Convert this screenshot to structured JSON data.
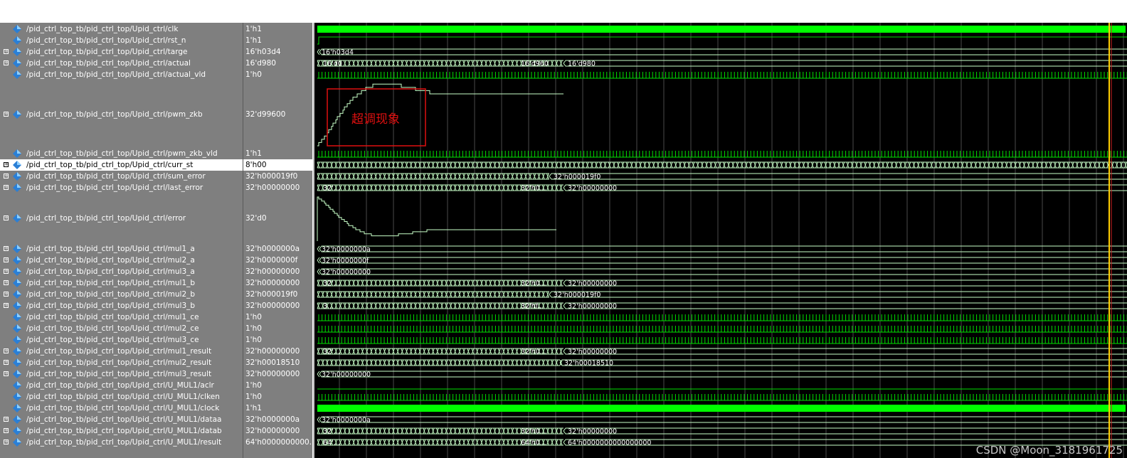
{
  "signals": [
    {
      "name": "/pid_ctrl_top_tb/pid_ctrl_top/Upid_ctrl/clk",
      "value": "1'h1",
      "expandable": false,
      "kind": "clk",
      "h": 16
    },
    {
      "name": "/pid_ctrl_top_tb/pid_ctrl_top/Upid_ctrl/rst_n",
      "value": "1'h1",
      "expandable": false,
      "kind": "high",
      "h": 16
    },
    {
      "name": "/pid_ctrl_top_tb/pid_ctrl_top/Upid_ctrl/targe",
      "value": "16'h03d4",
      "expandable": true,
      "kind": "bus",
      "h": 16,
      "labels": [
        "16'h03d4"
      ]
    },
    {
      "name": "/pid_ctrl_top_tb/pid_ctrl_top/Upid_ctrl/actual",
      "value": "16'd980",
      "expandable": true,
      "kind": "bus",
      "h": 16,
      "labels": [
        "16'd0",
        "16'd960",
        "16'd980"
      ]
    },
    {
      "name": "/pid_ctrl_top_tb/pid_ctrl_top/Upid_ctrl/actual_vld",
      "value": "1'h0",
      "expandable": false,
      "kind": "pulse",
      "h": 16
    },
    {
      "name": "/pid_ctrl_top_tb/pid_ctrl_top/Upid_ctrl/pwm_zkb",
      "value": "32'd99600",
      "expandable": true,
      "kind": "analog_up",
      "h": 95
    },
    {
      "name": "/pid_ctrl_top_tb/pid_ctrl_top/Upid_ctrl/pwm_zkb_vld",
      "value": "1'h1",
      "expandable": false,
      "kind": "pulse",
      "h": 16
    },
    {
      "name": "/pid_ctrl_top_tb/pid_ctrl_top/Upid_ctrl/curr_st",
      "value": "8'h00",
      "expandable": true,
      "kind": "bus",
      "h": 16,
      "selected": true,
      "labels": []
    },
    {
      "name": "/pid_ctrl_top_tb/pid_ctrl_top/Upid_ctrl/sum_error",
      "value": "32'h000019f0",
      "expandable": true,
      "kind": "bus",
      "h": 16,
      "labels": [
        "32'h000019f0"
      ]
    },
    {
      "name": "/pid_ctrl_top_tb/pid_ctrl_top/Upid_ctrl/last_error",
      "value": "32'h00000000",
      "expandable": true,
      "kind": "bus",
      "h": 16,
      "labels": [
        "32'...",
        "32'h0...",
        "32'h00000000"
      ]
    },
    {
      "name": "/pid_ctrl_top_tb/pid_ctrl_top/Upid_ctrl/error",
      "value": "32'd0",
      "expandable": true,
      "kind": "analog_down",
      "h": 70
    },
    {
      "name": "/pid_ctrl_top_tb/pid_ctrl_top/Upid_ctrl/mul1_a",
      "value": "32'h0000000a",
      "expandable": true,
      "kind": "bus",
      "h": 16,
      "labels": [
        "32'h0000000a"
      ]
    },
    {
      "name": "/pid_ctrl_top_tb/pid_ctrl_top/Upid_ctrl/mul2_a",
      "value": "32'h0000000f",
      "expandable": true,
      "kind": "bus",
      "h": 16,
      "labels": [
        "32'h0000000f"
      ]
    },
    {
      "name": "/pid_ctrl_top_tb/pid_ctrl_top/Upid_ctrl/mul3_a",
      "value": "32'h00000000",
      "expandable": true,
      "kind": "bus",
      "h": 16,
      "labels": [
        "32'h00000000"
      ]
    },
    {
      "name": "/pid_ctrl_top_tb/pid_ctrl_top/Upid_ctrl/mul1_b",
      "value": "32'h00000000",
      "expandable": true,
      "kind": "bus",
      "h": 16,
      "labels": [
        "32'...",
        "32'h0...",
        "32'h00000000"
      ]
    },
    {
      "name": "/pid_ctrl_top_tb/pid_ctrl_top/Upid_ctrl/mul2_b",
      "value": "32'h000019f0",
      "expandable": true,
      "kind": "bus",
      "h": 16,
      "labels": [
        "32'h000019f0"
      ]
    },
    {
      "name": "/pid_ctrl_top_tb/pid_ctrl_top/Upid_ctrl/mul3_b",
      "value": "32'h00000000",
      "expandable": true,
      "kind": "bus",
      "h": 16,
      "labels": [
        "3...",
        "32'hf...",
        "32'h...",
        "32'h00000000"
      ]
    },
    {
      "name": "/pid_ctrl_top_tb/pid_ctrl_top/Upid_ctrl/mul1_ce",
      "value": "1'h0",
      "expandable": false,
      "kind": "pulse",
      "h": 16
    },
    {
      "name": "/pid_ctrl_top_tb/pid_ctrl_top/Upid_ctrl/mul2_ce",
      "value": "1'h0",
      "expandable": false,
      "kind": "pulse",
      "h": 16
    },
    {
      "name": "/pid_ctrl_top_tb/pid_ctrl_top/Upid_ctrl/mul3_ce",
      "value": "1'h0",
      "expandable": false,
      "kind": "pulse",
      "h": 16
    },
    {
      "name": "/pid_ctrl_top_tb/pid_ctrl_top/Upid_ctrl/mul1_result",
      "value": "32'h00000000",
      "expandable": true,
      "kind": "bus",
      "h": 16,
      "labels": [
        "32'...",
        "32'h0...",
        "32'h00000000"
      ]
    },
    {
      "name": "/pid_ctrl_top_tb/pid_ctrl_top/Upid_ctrl/mul2_result",
      "value": "32'h00018510",
      "expandable": true,
      "kind": "bus",
      "h": 16,
      "labels": [
        "32'h00018510"
      ]
    },
    {
      "name": "/pid_ctrl_top_tb/pid_ctrl_top/Upid_ctrl/mul3_result",
      "value": "32'h00000000",
      "expandable": true,
      "kind": "bus",
      "h": 16,
      "labels": [
        "32'h00000000"
      ]
    },
    {
      "name": "/pid_ctrl_top_tb/pid_ctrl_top/Upid_ctrl/U_MUL1/aclr",
      "value": "1'h0",
      "expandable": false,
      "kind": "low",
      "h": 16
    },
    {
      "name": "/pid_ctrl_top_tb/pid_ctrl_top/Upid_ctrl/U_MUL1/clken",
      "value": "1'h0",
      "expandable": false,
      "kind": "pulse",
      "h": 16
    },
    {
      "name": "/pid_ctrl_top_tb/pid_ctrl_top/Upid_ctrl/U_MUL1/clock",
      "value": "1'h1",
      "expandable": false,
      "kind": "clk",
      "h": 16
    },
    {
      "name": "/pid_ctrl_top_tb/pid_ctrl_top/Upid_ctrl/U_MUL1/dataa",
      "value": "32'h0000000a",
      "expandable": true,
      "kind": "bus",
      "h": 16,
      "labels": [
        "32'h0000000a"
      ]
    },
    {
      "name": "/pid_ctrl_top_tb/pid_ctrl_top/Upid_ctrl/U_MUL1/datab",
      "value": "32'h00000000",
      "expandable": true,
      "kind": "bus",
      "h": 16,
      "labels": [
        "32'...",
        "32'h0...",
        "32'h00000000"
      ]
    },
    {
      "name": "/pid_ctrl_top_tb/pid_ctrl_top/Upid_ctrl/U_MUL1/result",
      "value": "64'h0000000000...",
      "expandable": true,
      "kind": "bus",
      "h": 16,
      "labels": [
        "64'...",
        "64'h0...",
        "64'h0000000000000000"
      ]
    }
  ],
  "annotation": {
    "text": "超调现象",
    "color": "#e01010"
  },
  "watermark": "CSDN @Moon_3181961725",
  "colors": {
    "wave": "#00e000",
    "clk": "#00ff00",
    "bus": "#c8ffc8",
    "analog": "#c8ffc8",
    "cursor": "#ffcc00"
  }
}
